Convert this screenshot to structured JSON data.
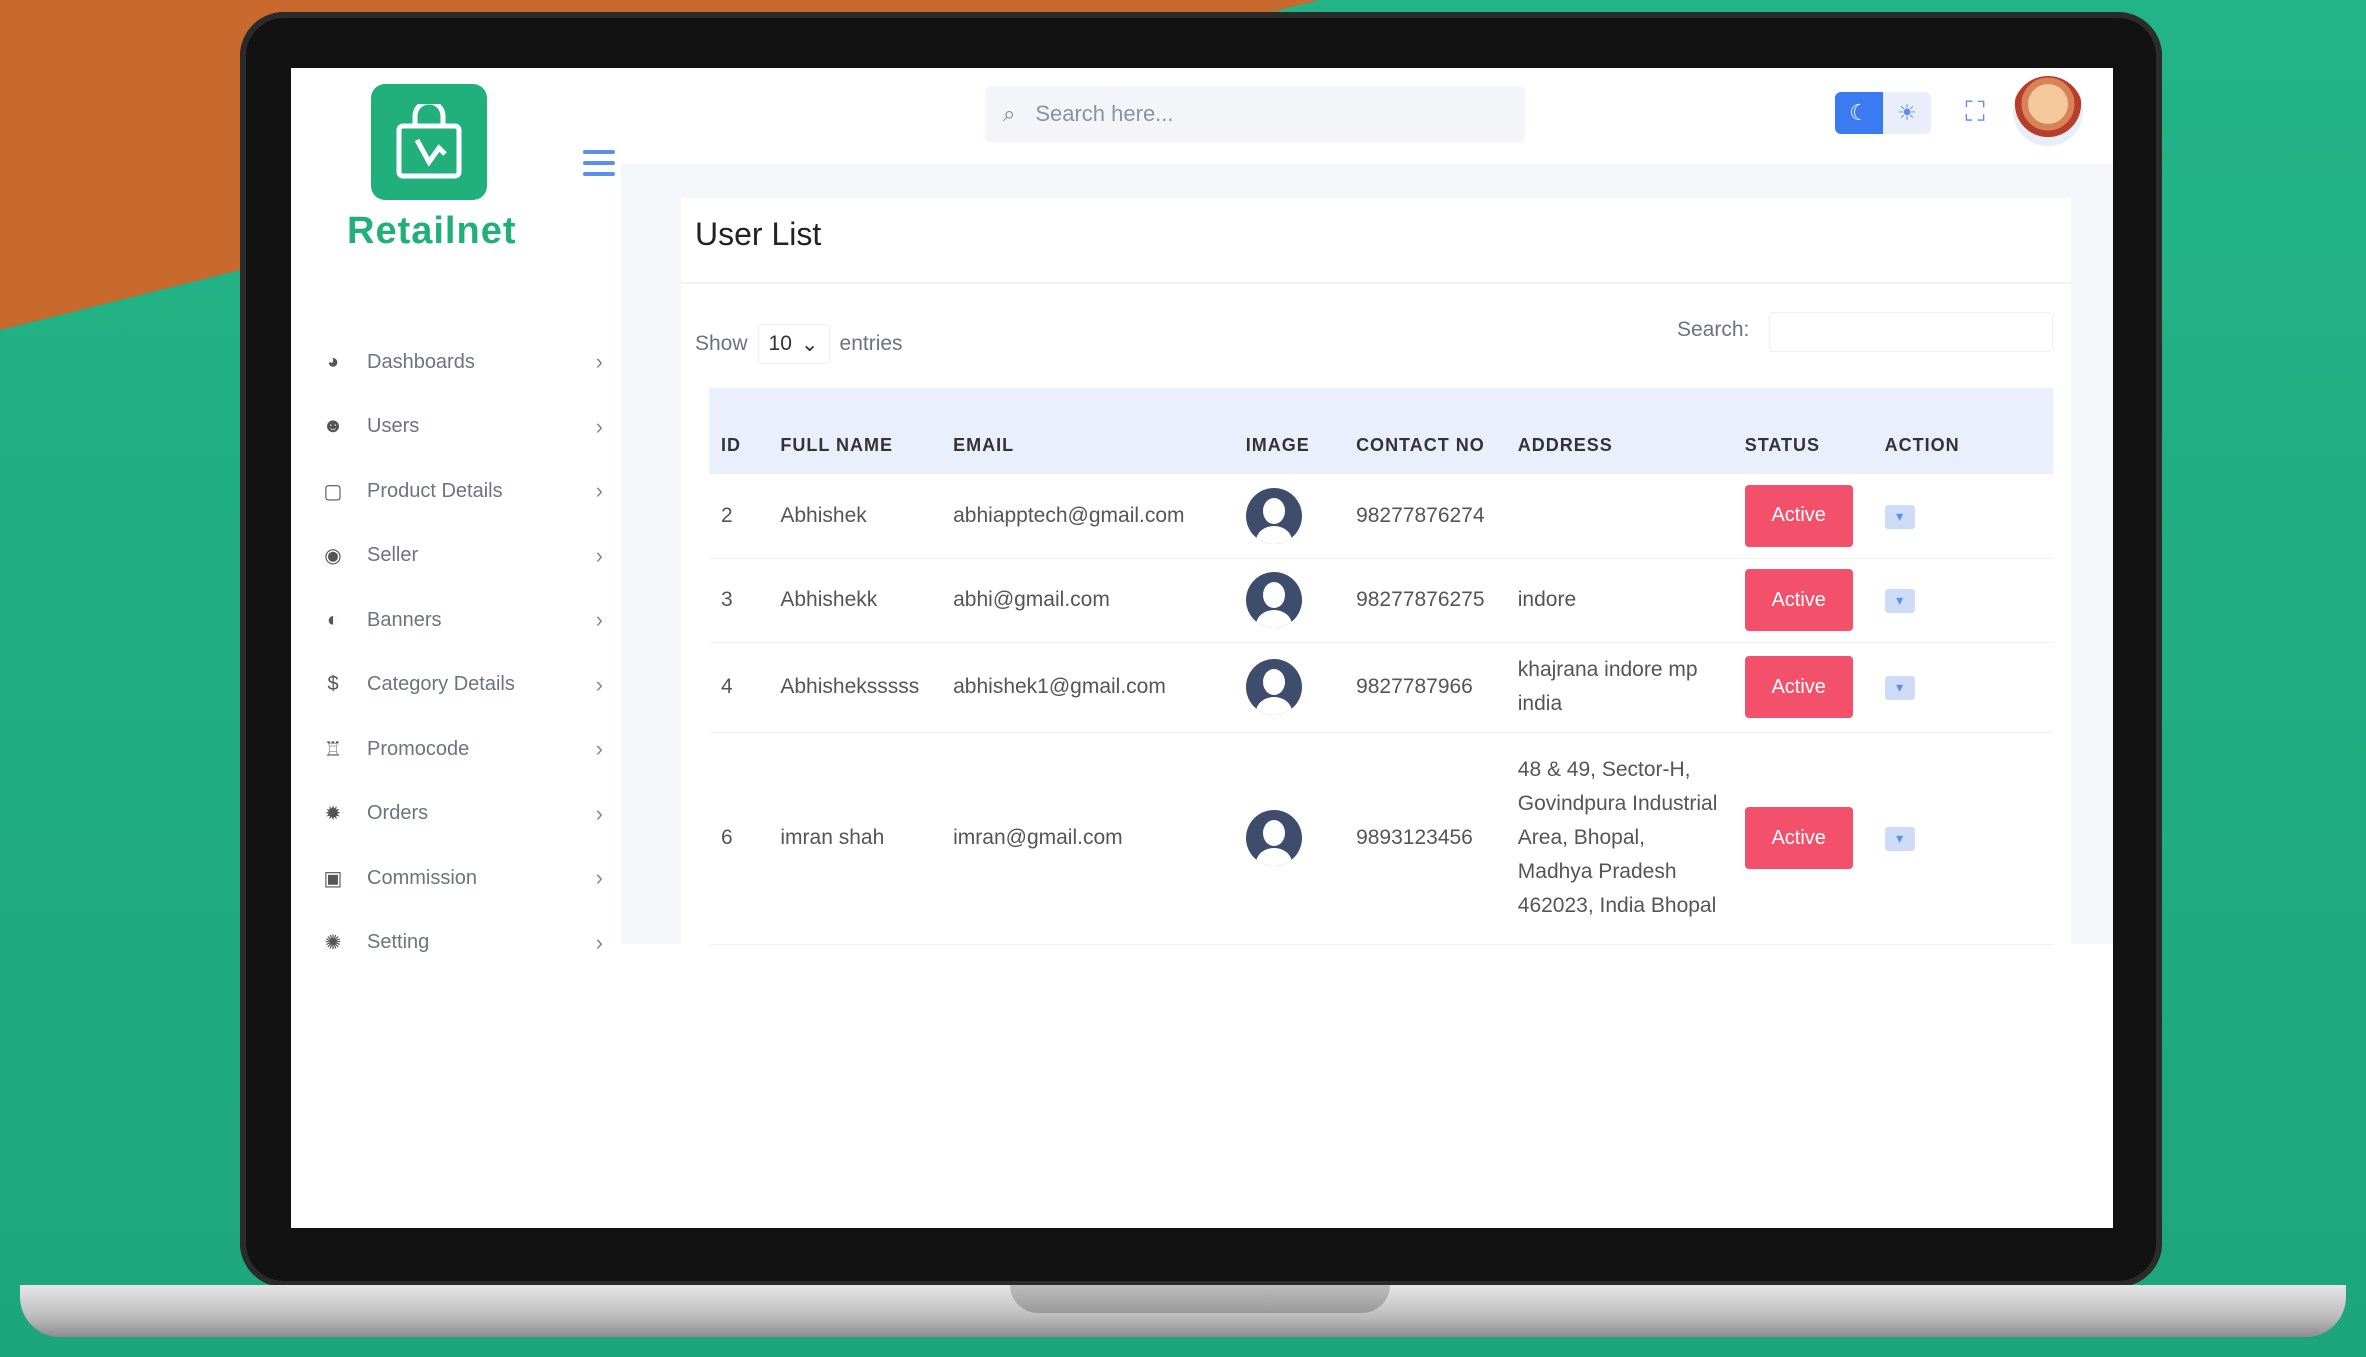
{
  "app": {
    "brand": "Retailnet"
  },
  "header": {
    "search_placeholder": "Search here..."
  },
  "sidebar": {
    "items": [
      {
        "label": "Dashboards",
        "icon": "dashboard-icon"
      },
      {
        "label": "Users",
        "icon": "users-icon"
      },
      {
        "label": "Product Details",
        "icon": "product-icon"
      },
      {
        "label": "Seller",
        "icon": "seller-icon"
      },
      {
        "label": "Banners",
        "icon": "banner-icon"
      },
      {
        "label": "Category Details",
        "icon": "category-icon"
      },
      {
        "label": "Promocode",
        "icon": "promocode-icon"
      },
      {
        "label": "Orders",
        "icon": "orders-icon"
      },
      {
        "label": "Commission",
        "icon": "commission-icon"
      },
      {
        "label": "Setting",
        "icon": "setting-icon"
      }
    ]
  },
  "page": {
    "title": "User List",
    "show_label": "Show",
    "entries_value": "10",
    "entries_label": "entries",
    "search_label": "Search:"
  },
  "table": {
    "headers": [
      "ID",
      "FULL NAME",
      "EMAIL",
      "IMAGE",
      "CONTACT NO",
      "ADDRESS",
      "STATUS",
      "ACTION"
    ],
    "rows": [
      {
        "id": "2",
        "name": "Abhishek",
        "email": "abhiapptech@gmail.com",
        "contact": "98277876274",
        "address": "",
        "status": "Active"
      },
      {
        "id": "3",
        "name": "Abhishekk",
        "email": "abhi@gmail.com",
        "contact": "98277876275",
        "address": "indore",
        "status": "Active"
      },
      {
        "id": "4",
        "name": "Abhisheksssss",
        "email": "abhishek1@gmail.com",
        "contact": "9827787966",
        "address": "khajrana indore mp india",
        "status": "Active"
      },
      {
        "id": "6",
        "name": "imran shah",
        "email": "imran@gmail.com",
        "contact": "9893123456",
        "address": "48 & 49, Sector-H, Govindpura Industrial Area, Bhopal, Madhya Pradesh 462023, India Bhopal",
        "status": "Active"
      }
    ]
  },
  "colors": {
    "brand_green": "#21b07c",
    "status_active": "#f2506b",
    "accent_blue": "#3b7bf2"
  }
}
